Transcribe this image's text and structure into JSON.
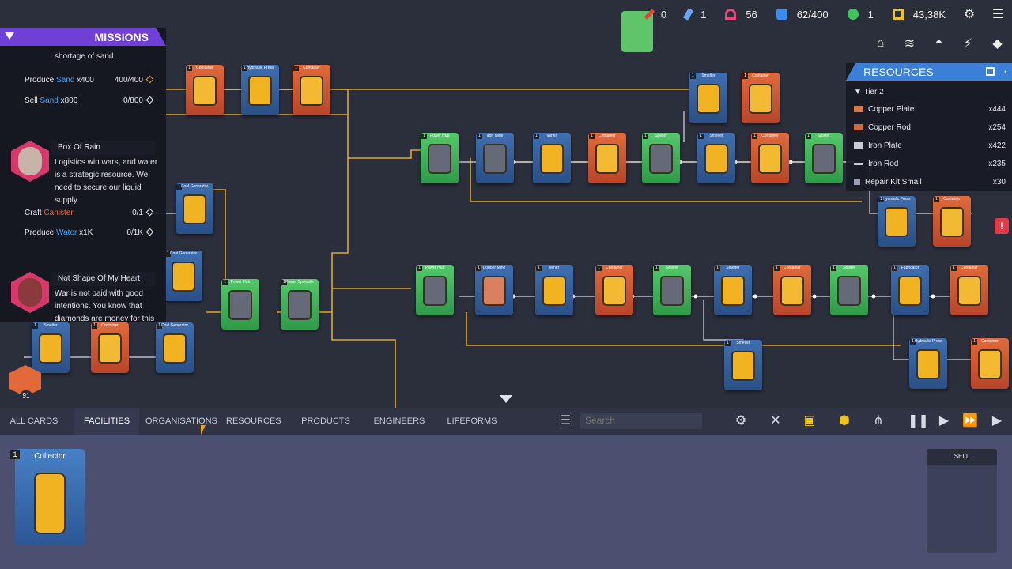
{
  "topbar": {
    "stats": [
      {
        "name": "pencil",
        "value": "0",
        "color": "#e2443b"
      },
      {
        "name": "ticket",
        "value": "1",
        "color": "#6aa6f5"
      },
      {
        "name": "network",
        "value": "56",
        "color": "#e8497a"
      },
      {
        "name": "storage",
        "value": "62/400",
        "color": "#3c8cf0"
      },
      {
        "name": "engineer",
        "value": "1",
        "color": "#3ec45a"
      },
      {
        "name": "money",
        "value": "43,38K",
        "color": "#f0c41e"
      }
    ]
  },
  "missions": {
    "title": "MISSIONS",
    "intro_line": "shortage of sand.",
    "mission1": {
      "rows": [
        {
          "label": "Produce",
          "item": "Sand",
          "qty": "x400",
          "progress": "400/400"
        },
        {
          "label": "Sell",
          "item": "Sand",
          "qty": "x800",
          "progress": "0/800"
        }
      ]
    },
    "mission2": {
      "title": "Box Of Rain",
      "text": "Logistics win wars, and water is a strategic resource. We need to secure our liquid supply.",
      "rows": [
        {
          "label": "Craft",
          "item": "Canister",
          "qty": "",
          "progress": "0/1"
        },
        {
          "label": "Produce",
          "item": "Water",
          "qty": "x1K",
          "progress": "0/1K"
        }
      ]
    },
    "mission3": {
      "title": "Not Shape Of My Heart",
      "text": "War is not paid with good intentions. You know that diamonds are money for this art"
    },
    "engineer_level": "91"
  },
  "resources": {
    "title": "RESOURCES",
    "group": "Tier 2",
    "items": [
      {
        "name": "Copper Plate",
        "count": "x444",
        "color": "#d97a4a"
      },
      {
        "name": "Copper Rod",
        "count": "x254",
        "color": "#d06a3a"
      },
      {
        "name": "Iron Plate",
        "count": "x422",
        "color": "#c9ccd6"
      },
      {
        "name": "Iron Rod",
        "count": "x235",
        "color": "#c9ccd6"
      },
      {
        "name": "Repair Kit Small",
        "count": "x30",
        "color": "#9aa0b4"
      }
    ]
  },
  "tabs": {
    "all_cards": "ALL CARDS",
    "facilities": "FACILITIES",
    "organisations": "ORGANISATIONS",
    "resources": "RESOURCES",
    "products": "PRODUCTS",
    "engineers": "ENGINEERS",
    "lifeforms": "LIFEFORMS"
  },
  "search": {
    "placeholder": "Search"
  },
  "tray": {
    "collector": {
      "name": "Collector",
      "tier": "1"
    },
    "sell_label": "SELL"
  },
  "board": {
    "cards": [
      {
        "label": "Container",
        "color": "orange"
      },
      {
        "label": "Hydraulic Press",
        "color": "blue"
      },
      {
        "label": "Container",
        "color": "orange"
      },
      {
        "label": "Coal Generator",
        "color": "blue"
      },
      {
        "label": "Coal Generator",
        "color": "blue"
      },
      {
        "label": "Power Hub",
        "color": "green"
      },
      {
        "label": "Power Spreader",
        "color": "green"
      },
      {
        "label": "Smelter",
        "color": "blue"
      },
      {
        "label": "Container",
        "color": "orange"
      },
      {
        "label": "Coal Generator",
        "color": "blue"
      },
      {
        "label": "Power Hub",
        "color": "green"
      },
      {
        "label": "Iron Mine",
        "color": "blue"
      },
      {
        "label": "Miner",
        "color": "blue"
      },
      {
        "label": "Container",
        "color": "orange"
      },
      {
        "label": "Splitter",
        "color": "green"
      },
      {
        "label": "Smelter",
        "color": "blue"
      },
      {
        "label": "Container",
        "color": "orange"
      },
      {
        "label": "Splitter",
        "color": "green"
      },
      {
        "label": "Smelter",
        "color": "blue"
      },
      {
        "label": "Container",
        "color": "orange"
      },
      {
        "label": "Power Hub",
        "color": "green"
      },
      {
        "label": "Copper Mine",
        "color": "blue"
      },
      {
        "label": "Miner",
        "color": "blue"
      },
      {
        "label": "Container",
        "color": "orange"
      },
      {
        "label": "Splitter",
        "color": "green"
      },
      {
        "label": "Smelter",
        "color": "blue"
      },
      {
        "label": "Container",
        "color": "orange"
      },
      {
        "label": "Splitter",
        "color": "green"
      },
      {
        "label": "Fabricator",
        "color": "blue"
      },
      {
        "label": "Container",
        "color": "orange"
      },
      {
        "label": "Smelter",
        "color": "blue"
      },
      {
        "label": "Hydraulic Press",
        "color": "blue"
      },
      {
        "label": "Container",
        "color": "orange"
      },
      {
        "label": "Hydraulic Press",
        "color": "blue"
      },
      {
        "label": "Container",
        "color": "orange"
      }
    ]
  }
}
